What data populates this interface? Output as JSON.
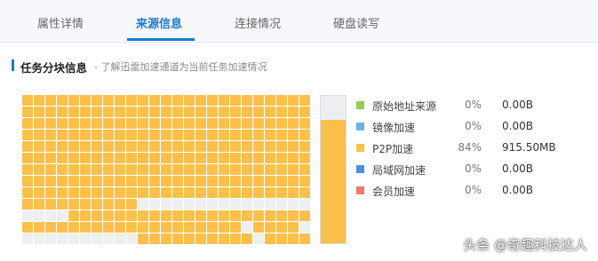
{
  "tabs": [
    {
      "label": "属性详情",
      "active": false
    },
    {
      "label": "来源信息",
      "active": true
    },
    {
      "label": "连接情况",
      "active": false
    },
    {
      "label": "硬盘读写",
      "active": false
    }
  ],
  "section": {
    "title": "任务分块信息",
    "description": "- 了解迅雷加速通道为当前任务加速情况"
  },
  "blocks": {
    "rows": [
      "1111111111111111111111111",
      "1111111111111111111111111",
      "1111111111111111111111111",
      "1111111111111111111111111",
      "1111111111111111111111111",
      "1111111111111111111111111",
      "1111111111111111111111111",
      "1111111111111111111111111",
      "1111111111111111111111111",
      "1111111111000000000000000",
      "0000111111111111111111111",
      "1111111111111111111011110",
      "0000000000111111111101111"
    ],
    "overall_progress": 0.84
  },
  "legend": [
    {
      "label": "原始地址来源",
      "percent": "0%",
      "size": "0.00B",
      "color": "#8fd14f"
    },
    {
      "label": "镜像加速",
      "percent": "0%",
      "size": "0.00B",
      "color": "#6ab4e8"
    },
    {
      "label": "P2P加速",
      "percent": "84%",
      "size": "915.50MB",
      "color": "#fac04a"
    },
    {
      "label": "局域网加速",
      "percent": "0%",
      "size": "0.00B",
      "color": "#4a90e2"
    },
    {
      "label": "会员加速",
      "percent": "0%",
      "size": "0.00B",
      "color": "#f07a6a"
    }
  ],
  "watermark": "头条 @奇趣科技达人",
  "colors": {
    "accent": "#1a7ad6",
    "filled": "#fac04a",
    "empty": "#eeeff1"
  }
}
